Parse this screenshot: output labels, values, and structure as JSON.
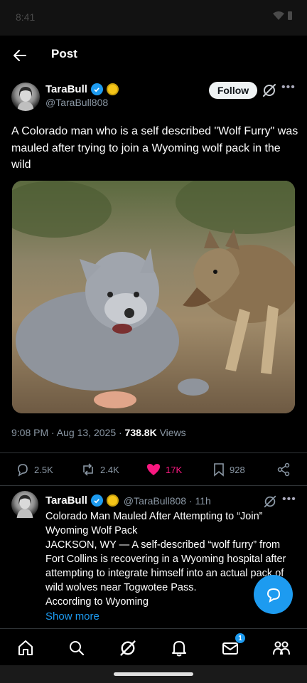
{
  "status_bar": {
    "time": "8:41"
  },
  "header": {
    "title": "Post"
  },
  "post": {
    "author_name": "TaraBull",
    "author_handle": "@TaraBull808",
    "follow_label": "Follow",
    "text": "A Colorado man who is a self described \"Wolf Furry\" was mauled after trying to join a Wyoming wolf pack in the wild",
    "meta_time": "9:08 PM · Aug 13, 2025 · ",
    "meta_views_count": "738.8K",
    "meta_views_label": " Views",
    "stats": {
      "replies": "2.5K",
      "reposts": "2.4K",
      "likes": "17K",
      "bookmarks": "928"
    }
  },
  "reply": {
    "author_name": "TaraBull",
    "handle_time": "@TaraBull808 · 11h",
    "line1": "Colorado Man Mauled After Attempting to “Join” Wyoming Wolf Pack",
    "line2": "JACKSON, WY — A self-described “wolf furry” from Fort Collins is recovering in a Wyoming hospital after attempting to integrate himself into an actual pack of wild wolves near Togwotee Pass.",
    "line3": "According to Wyoming",
    "show_more": "Show more"
  },
  "bottom_nav": {
    "notification_count": "1"
  },
  "colors": {
    "accent": "#1d9bf0",
    "like": "#f91880",
    "gold_badge": "#f5c518"
  },
  "icons": [
    "back-arrow-icon",
    "verified-badge-icon",
    "gold-badge-icon",
    "grok-icon",
    "more-icon",
    "reply-icon",
    "repost-icon",
    "heart-icon",
    "bookmark-icon",
    "share-icon",
    "compose-message-icon",
    "home-icon",
    "search-icon",
    "notifications-icon",
    "messages-icon",
    "communities-icon"
  ]
}
